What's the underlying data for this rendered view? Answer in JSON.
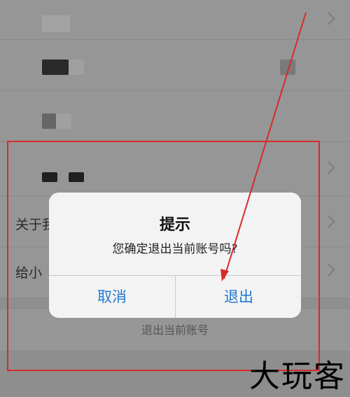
{
  "settings": {
    "about_label": "关于我",
    "feedback_label": "给小",
    "logout_label": "退出当前账号"
  },
  "dialog": {
    "title": "提示",
    "message": "您确定退出当前账号吗?",
    "cancel_label": "取消",
    "confirm_label": "退出"
  },
  "watermark": "大玩客",
  "colors": {
    "annotation_red": "#d62b2b",
    "button_blue": "#1f78d1"
  }
}
